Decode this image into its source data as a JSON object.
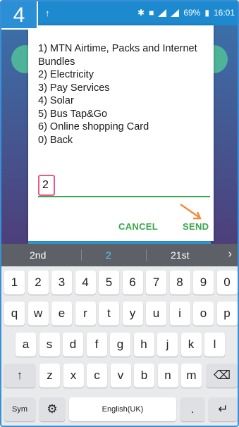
{
  "step_badge": "4",
  "status": {
    "battery_text": "69%",
    "time": "16:01"
  },
  "dialog": {
    "menu": [
      "1) MTN Airtime, Packs and Internet Bundles",
      "2) Electricity",
      "3) Pay Services",
      "4) Solar",
      "5) Bus Tap&Go",
      "6) Online shopping Card",
      "0) Back"
    ],
    "input_value": "2",
    "cancel_label": "CANCEL",
    "send_label": "SEND"
  },
  "keyboard": {
    "suggestions": [
      "2nd",
      "2",
      "21st"
    ],
    "row_numbers": [
      "1",
      "2",
      "3",
      "4",
      "5",
      "6",
      "7",
      "8",
      "9",
      "0"
    ],
    "row_top": [
      "q",
      "w",
      "e",
      "r",
      "t",
      "y",
      "u",
      "i",
      "o",
      "p"
    ],
    "row_middle": [
      "a",
      "s",
      "d",
      "f",
      "g",
      "h",
      "j",
      "k",
      "l"
    ],
    "row_bottom": [
      "z",
      "x",
      "c",
      "v",
      "b",
      "n",
      "m"
    ],
    "sym_label": "Sym",
    "space_label": "English(UK)",
    "dot_label": "."
  },
  "colors": {
    "accent_green": "#3aa64a",
    "badge_blue": "#2b8fd5",
    "highlight_pink": "#e85a8a",
    "arrow_orange": "#f08a3c"
  }
}
